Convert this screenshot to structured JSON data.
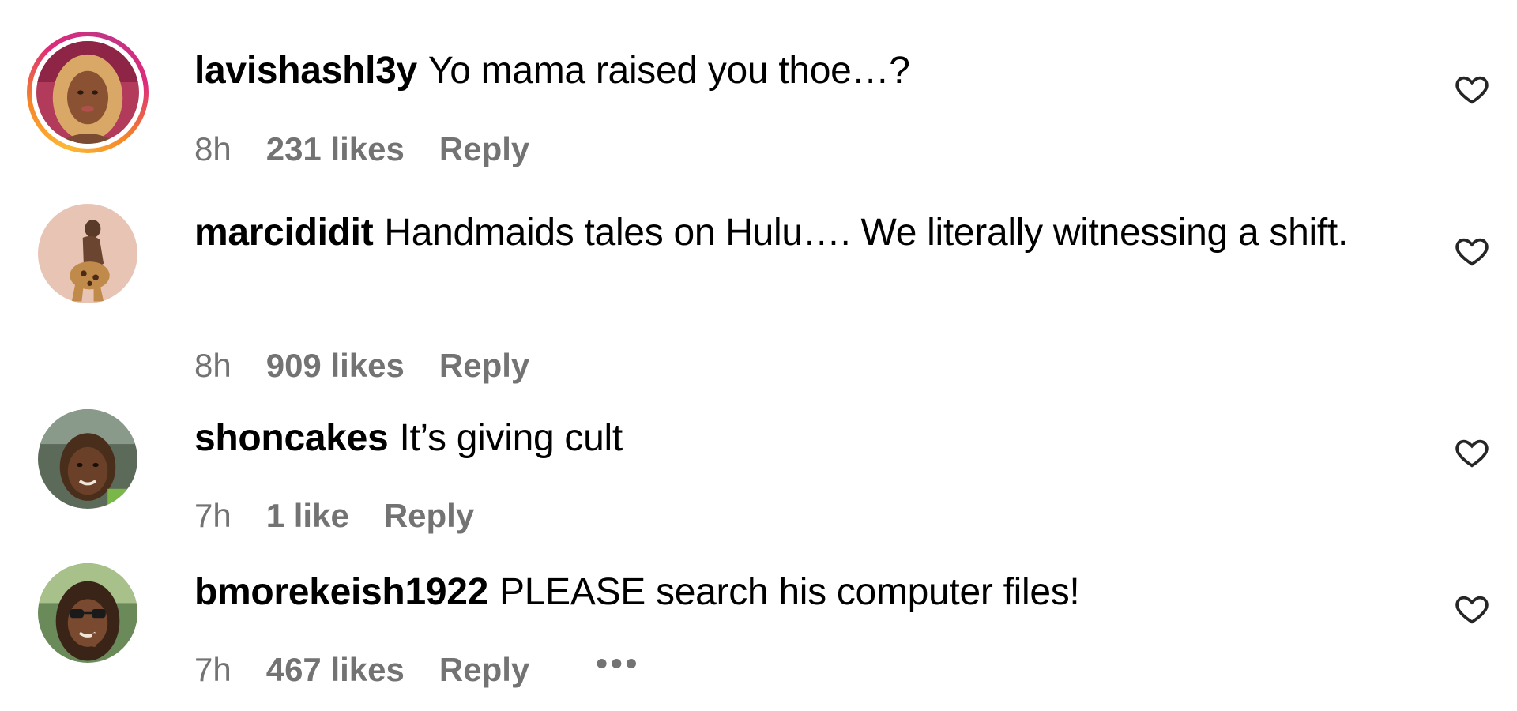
{
  "comments": [
    {
      "username": "lavishashl3y",
      "text": "Yo mama raised you thoe…?",
      "time": "8h",
      "likes": "231 likes",
      "reply_label": "Reply",
      "has_story_ring": true,
      "liked": false
    },
    {
      "username": "marcididit",
      "text": "Handmaids tales on Hulu…. We literally witnessing a shift.",
      "time": "8h",
      "likes": "909 likes",
      "reply_label": "Reply",
      "has_story_ring": false,
      "liked": false
    },
    {
      "username": "shoncakes",
      "text": "It’s giving cult",
      "time": "7h",
      "likes": "1 like",
      "reply_label": "Reply",
      "has_story_ring": false,
      "liked": false
    },
    {
      "username": "bmorekeish1922",
      "text": "PLEASE search his computer files!",
      "time": "7h",
      "likes": "467 likes",
      "reply_label": "Reply",
      "more_label": "•••",
      "has_story_ring": false,
      "liked": false
    }
  ],
  "colors": {
    "text": "#000000",
    "meta": "#737373",
    "story_ring": [
      "#fdb933",
      "#f58529",
      "#dd2a7b",
      "#c13584"
    ]
  },
  "icons": {
    "like": "heart-outline-icon",
    "more": "more-options-icon"
  }
}
